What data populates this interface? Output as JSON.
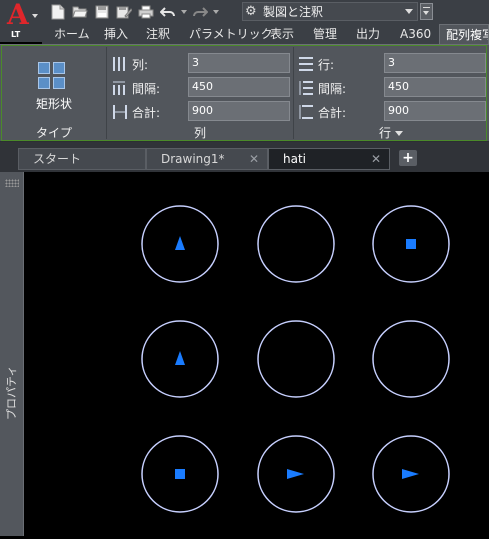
{
  "app": {
    "logo_letter": "A",
    "edition": "LT"
  },
  "quick_access": {
    "icons": [
      "new-icon",
      "open-icon",
      "save-icon",
      "save-as-icon",
      "print-icon",
      "undo-icon",
      "redo-icon"
    ],
    "workspace": "製図と注釈"
  },
  "ribbon_tabs": [
    {
      "label": "ホーム",
      "active": false
    },
    {
      "label": "挿入",
      "active": false
    },
    {
      "label": "注釈",
      "active": false
    },
    {
      "label": "パラメトリック",
      "active": false
    },
    {
      "label": "表示",
      "active": false
    },
    {
      "label": "管理",
      "active": false
    },
    {
      "label": "出力",
      "active": false
    },
    {
      "label": "A360",
      "active": false
    },
    {
      "label": "配列複写",
      "active": true
    }
  ],
  "ribbon": {
    "type_panel": {
      "button_label": "矩形状",
      "title": "タイプ"
    },
    "column_panel": {
      "title": "列",
      "rows": [
        {
          "label": "列:",
          "value": "3"
        },
        {
          "label": "間隔:",
          "value": "450"
        },
        {
          "label": "合計:",
          "value": "900"
        }
      ]
    },
    "row_panel": {
      "title": "行",
      "rows": [
        {
          "label": "行:",
          "value": "3"
        },
        {
          "label": "間隔:",
          "value": "450"
        },
        {
          "label": "合計:",
          "value": "900"
        }
      ]
    }
  },
  "doc_tabs": [
    {
      "label": "スタート",
      "active": false,
      "closable": false
    },
    {
      "label": "Drawing1*",
      "active": false,
      "closable": true
    },
    {
      "label": "hati",
      "active": true,
      "closable": true
    }
  ],
  "new_tab": "+",
  "properties_label": "プロパティ",
  "drawing": {
    "circle_color": "#c7d0ff",
    "mark_color": "#1a7cff",
    "cells": [
      {
        "mark": "triangle-up"
      },
      {
        "mark": "none"
      },
      {
        "mark": "square"
      },
      {
        "mark": "triangle-up"
      },
      {
        "mark": "none"
      },
      {
        "mark": "none"
      },
      {
        "mark": "square"
      },
      {
        "mark": "triangle-right"
      },
      {
        "mark": "triangle-right"
      }
    ]
  }
}
